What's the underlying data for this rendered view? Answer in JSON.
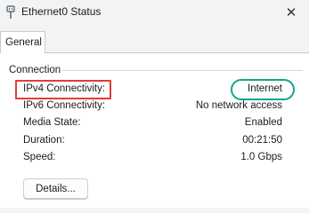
{
  "window": {
    "title": "Ethernet0 Status",
    "close_glyph": "✕",
    "icon": "ethernet-icon"
  },
  "tabs": [
    {
      "label": "General",
      "selected": true
    }
  ],
  "connection": {
    "group_label": "Connection",
    "rows": [
      {
        "label": "IPv4 Connectivity:",
        "value": "Internet"
      },
      {
        "label": "IPv6 Connectivity:",
        "value": "No network access"
      },
      {
        "label": "Media State:",
        "value": "Enabled"
      },
      {
        "label": "Duration:",
        "value": "00:21:50"
      },
      {
        "label": "Speed:",
        "value": "1.0 Gbps"
      }
    ]
  },
  "buttons": {
    "details_label": "Details..."
  },
  "colors": {
    "highlight_box": "#e23b3b",
    "highlight_oval": "#15a38a"
  }
}
